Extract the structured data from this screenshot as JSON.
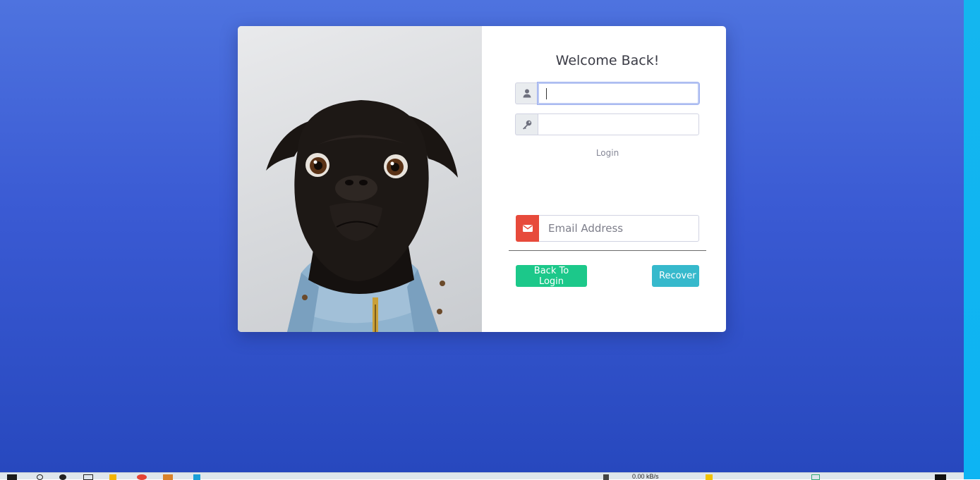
{
  "login_card": {
    "title": "Welcome Back!",
    "username_value": "",
    "password_value": "",
    "login_link": "Login"
  },
  "recover_form": {
    "email_placeholder": "Email Address",
    "back_button": "Back To Login",
    "recover_button": "Recover"
  },
  "taskbar": {
    "network_speed": "0.00 kB/s"
  },
  "icons": {
    "username": "user-icon",
    "password": "key-icon",
    "email": "envelope-icon"
  },
  "colors": {
    "background": "#4e73df",
    "email_addon": "#e74a3b",
    "back_button": "#1cc88a",
    "recover_button": "#36b9cc"
  }
}
